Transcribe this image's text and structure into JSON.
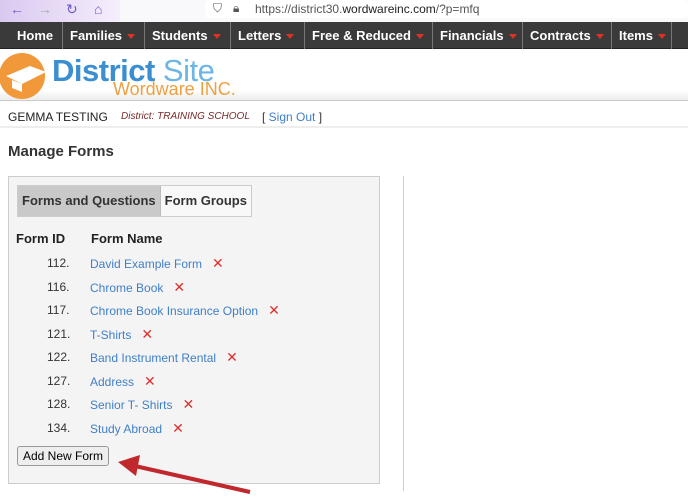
{
  "browser": {
    "url_prefix": "https://district30.",
    "url_domain": "wordwareinc.com",
    "url_suffix": "/?p=mfq"
  },
  "nav": {
    "items": [
      {
        "label": "Home",
        "dropdown": false
      },
      {
        "label": "Families",
        "dropdown": true
      },
      {
        "label": "Students",
        "dropdown": true
      },
      {
        "label": "Letters",
        "dropdown": true
      },
      {
        "label": "Free & Reduced",
        "dropdown": true
      },
      {
        "label": "Financials",
        "dropdown": true
      },
      {
        "label": "Contracts",
        "dropdown": true
      },
      {
        "label": "Items",
        "dropdown": true
      }
    ]
  },
  "logo": {
    "title_bold": "District",
    "title_light": " Site",
    "subtitle": "Wordware INC."
  },
  "user": {
    "name": "GEMMA TESTING",
    "district": "District: TRAINING SCHOOL",
    "signout_open": "[ ",
    "signout": "Sign Out",
    "signout_close": " ]"
  },
  "page": {
    "title": "Manage Forms"
  },
  "tabs": [
    {
      "label": "Forms and Questions",
      "active": true
    },
    {
      "label": "Form Groups",
      "active": false
    }
  ],
  "table": {
    "headers": [
      "Form ID",
      "Form Name"
    ],
    "rows": [
      {
        "id": "112.",
        "name": "David Example Form"
      },
      {
        "id": "116.",
        "name": "Chrome Book"
      },
      {
        "id": "117.",
        "name": "Chrome Book Insurance Option"
      },
      {
        "id": "121.",
        "name": "T-Shirts"
      },
      {
        "id": "122.",
        "name": "Band Instrument Rental"
      },
      {
        "id": "127.",
        "name": "Address"
      },
      {
        "id": "128.",
        "name": "Senior T- Shirts"
      },
      {
        "id": "134.",
        "name": "Study Abroad"
      }
    ],
    "delete_icon": "close-x-icon"
  },
  "add_button": "Add New Form",
  "colors": {
    "nav": "#3a3a3a",
    "link": "#3f7fc8",
    "delete": "#e03030",
    "arrow": "#c0282e",
    "logo_orange": "#f0983a"
  }
}
